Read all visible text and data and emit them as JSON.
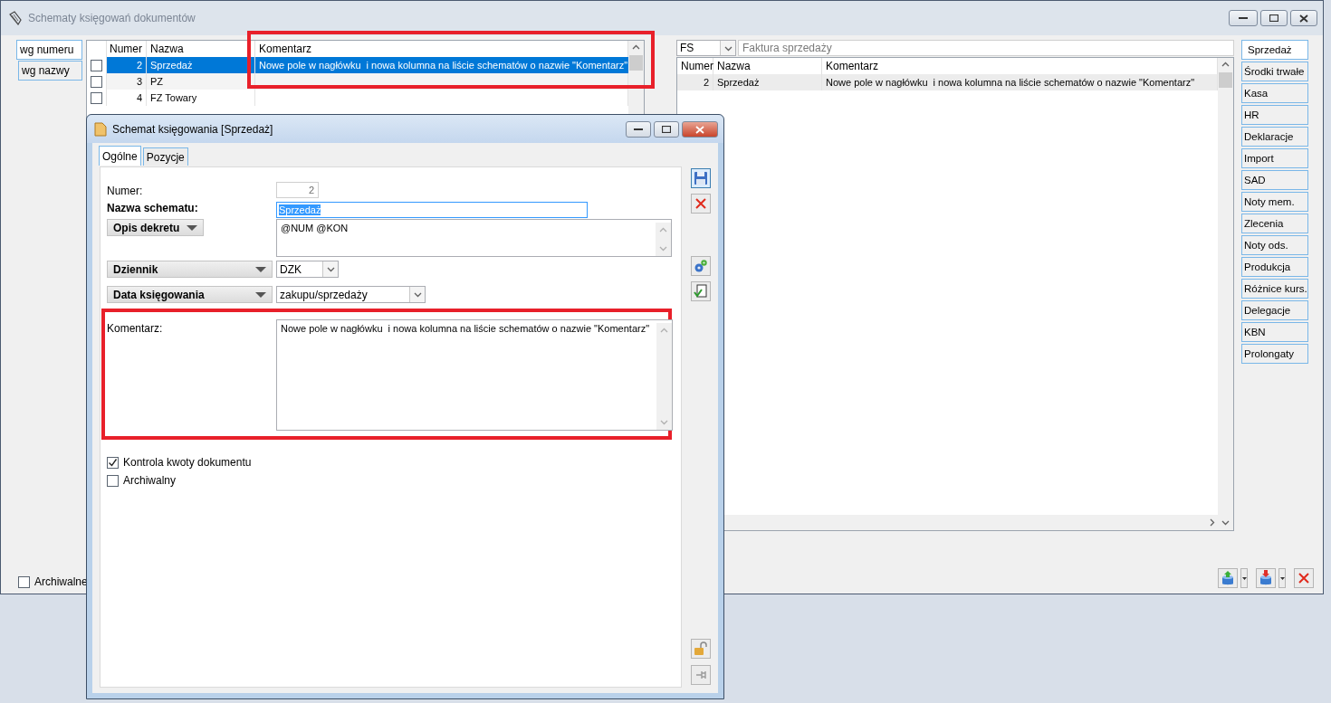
{
  "main_window": {
    "title": "Schematy księgowań dokumentów",
    "sort_tabs": [
      {
        "label": "wg numeru",
        "selected": true
      },
      {
        "label": "wg nazwy",
        "selected": false
      }
    ],
    "list": {
      "columns": [
        "Numer",
        "Nazwa",
        "Komentarz"
      ],
      "rows": [
        {
          "checked": false,
          "numer": "2",
          "nazwa": "Sprzedaż",
          "komentarz": "Nowe pole w nagłówku  i nowa kolumna na liście schematów o nazwie \"Komentarz\"",
          "selected": true
        },
        {
          "checked": false,
          "numer": "3",
          "nazwa": "PZ",
          "komentarz": "",
          "selected": false
        },
        {
          "checked": false,
          "numer": "4",
          "nazwa": "FZ Towary",
          "komentarz": "",
          "selected": false
        }
      ]
    },
    "archiwalne": {
      "label": "Archiwalne",
      "checked": false
    },
    "document_type": {
      "code": "FS",
      "name": "Faktura sprzedaży"
    },
    "schemes": {
      "columns": [
        "Numer",
        "Nazwa",
        "Komentarz"
      ],
      "rows": [
        {
          "numer": "2",
          "nazwa": "Sprzedaż",
          "komentarz": "Nowe pole w nagłówku  i nowa kolumna na liście schematów o nazwie \"Komentarz\"",
          "selected": true
        }
      ]
    },
    "categories": [
      {
        "label": "Sprzedaż",
        "selected": true
      },
      {
        "label": "Środki trwałe",
        "selected": false
      },
      {
        "label": "Kasa",
        "selected": false
      },
      {
        "label": "HR",
        "selected": false
      },
      {
        "label": "Deklaracje",
        "selected": false
      },
      {
        "label": "Import",
        "selected": false
      },
      {
        "label": "SAD",
        "selected": false
      },
      {
        "label": "Noty mem.",
        "selected": false
      },
      {
        "label": "Zlecenia",
        "selected": false
      },
      {
        "label": "Noty ods.",
        "selected": false
      },
      {
        "label": "Produkcja",
        "selected": false
      },
      {
        "label": "Różnice kurs.",
        "selected": false
      },
      {
        "label": "Delegacje",
        "selected": false
      },
      {
        "label": "KBN",
        "selected": false
      },
      {
        "label": "Prolongaty",
        "selected": false
      }
    ]
  },
  "dialog": {
    "title": "Schemat księgowania [Sprzedaż]",
    "tabs": [
      {
        "label": "Ogólne",
        "selected": true
      },
      {
        "label": "Pozycje",
        "selected": false
      }
    ],
    "numer": {
      "label": "Numer:",
      "value": "2",
      "disabled": true
    },
    "nazwa_schematu": {
      "label": "Nazwa schematu:",
      "value": "Sprzedaż",
      "value_selected": true
    },
    "opis_dekretu": {
      "label": "Opis dekretu",
      "value": "@NUM @KON"
    },
    "dziennik": {
      "label": "Dziennik",
      "value": "DZK"
    },
    "data_ksiegowania": {
      "label": "Data księgowania",
      "value": "zakupu/sprzedaży"
    },
    "komentarz": {
      "label": "Komentarz:",
      "value": "Nowe pole w nagłówku  i nowa kolumna na liście schematów o nazwie \"Komentarz\""
    },
    "checkboxes": [
      {
        "label": "Kontrola kwoty dokumentu",
        "checked": true
      },
      {
        "label": "Archiwalny",
        "checked": false
      }
    ]
  }
}
